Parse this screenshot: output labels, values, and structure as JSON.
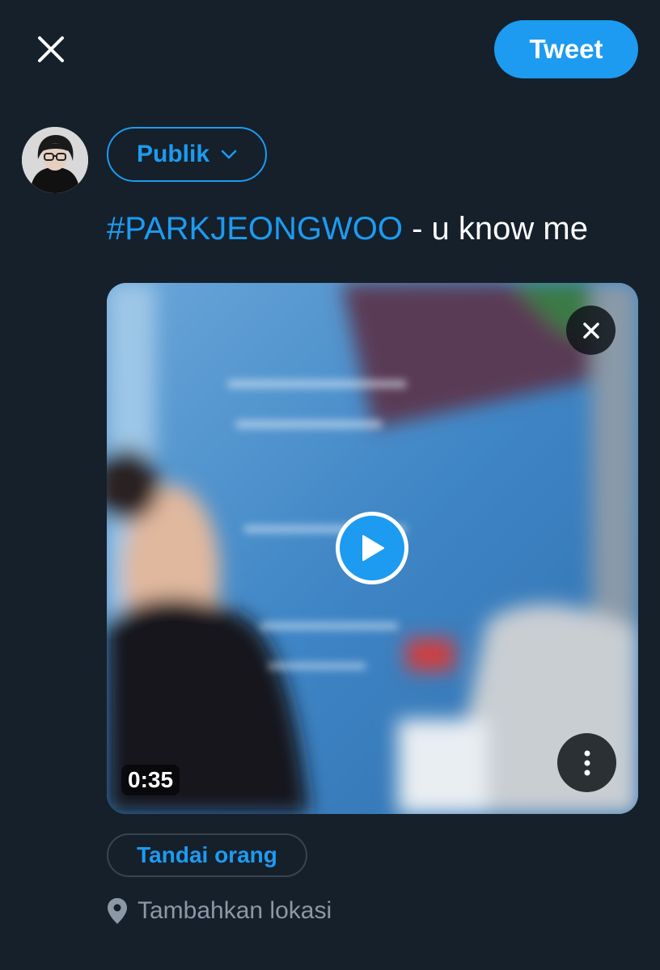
{
  "header": {
    "close_icon": "close-icon",
    "tweet_label": "Tweet"
  },
  "composer": {
    "audience_label": "Publik",
    "audience_icon": "chevron-down-icon",
    "hashtag": "#PARKJEONGWOO",
    "text": " - u know me"
  },
  "media": {
    "duration": "0:35",
    "remove_icon": "close-icon",
    "play_icon": "play-icon",
    "more_icon": "more-vertical-icon"
  },
  "actions": {
    "tag_people_label": "Tandai orang",
    "location_label": "Tambahkan lokasi",
    "location_icon": "location-pin-icon"
  },
  "colors": {
    "background": "#15202b",
    "accent": "#1d9bf0",
    "muted_text": "#8b98a5",
    "border": "#38444d"
  }
}
